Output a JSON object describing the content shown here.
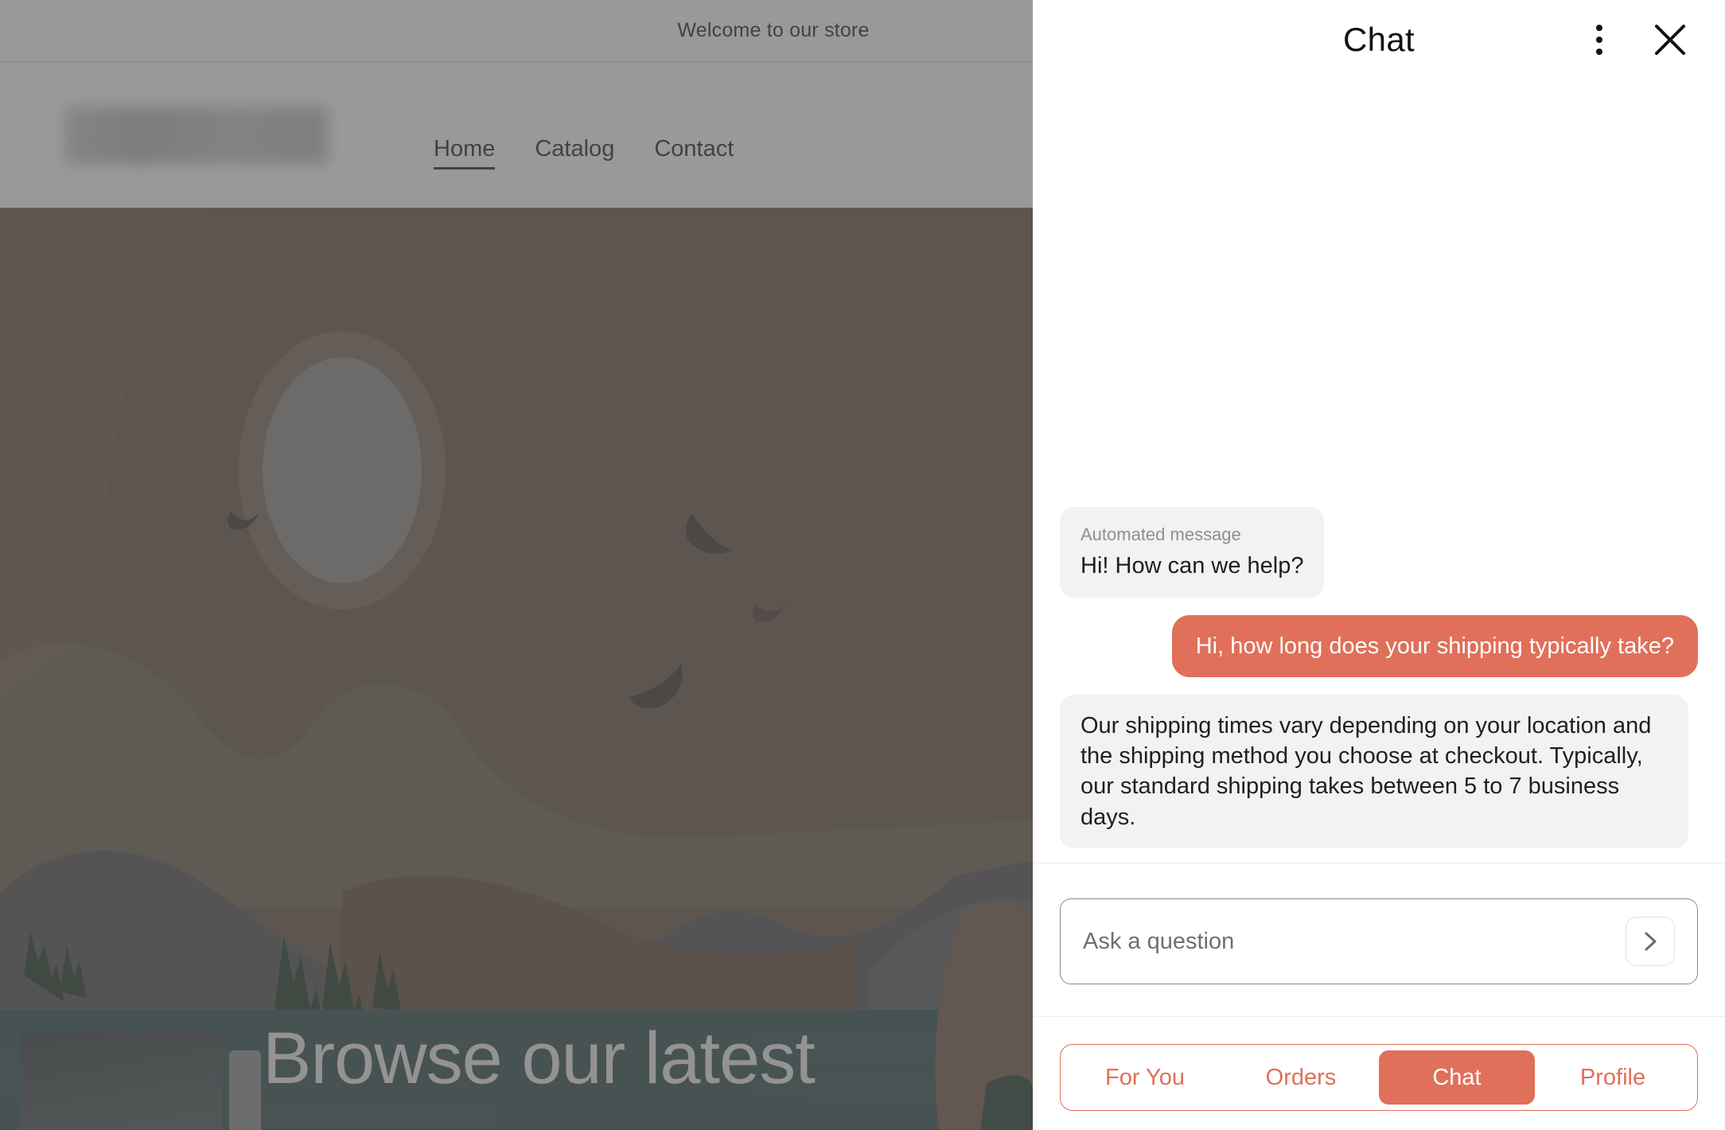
{
  "store": {
    "announcement": "Welcome to our store",
    "logo_alt": "store-logo",
    "nav": [
      {
        "label": "Home",
        "active": true
      },
      {
        "label": "Catalog",
        "active": false
      },
      {
        "label": "Contact",
        "active": false
      }
    ],
    "hero_heading": "Browse our latest"
  },
  "chat": {
    "title": "Chat",
    "menu_icon": "kebab-menu-icon",
    "close_icon": "close-icon",
    "messages": [
      {
        "sender": "bot",
        "label": "Automated message",
        "text": "Hi! How can we help?"
      },
      {
        "sender": "user",
        "label": "",
        "text": "Hi, how long does your shipping typically take?"
      },
      {
        "sender": "bot",
        "label": "",
        "text": "Our shipping times vary depending on your location and the shipping method you choose at checkout. Typically, our standard shipping takes between 5 to 7 business days."
      }
    ],
    "composer": {
      "placeholder": "Ask a question",
      "value": "",
      "send_icon": "chevron-right-icon"
    },
    "tabs": [
      {
        "label": "For You",
        "active": false
      },
      {
        "label": "Orders",
        "active": false
      },
      {
        "label": "Chat",
        "active": true
      },
      {
        "label": "Profile",
        "active": false
      }
    ]
  },
  "colors": {
    "accent": "#e0705a",
    "bot_bubble": "#f2f2f2",
    "text": "#1f1f1f",
    "muted": "#8f8f8f"
  }
}
